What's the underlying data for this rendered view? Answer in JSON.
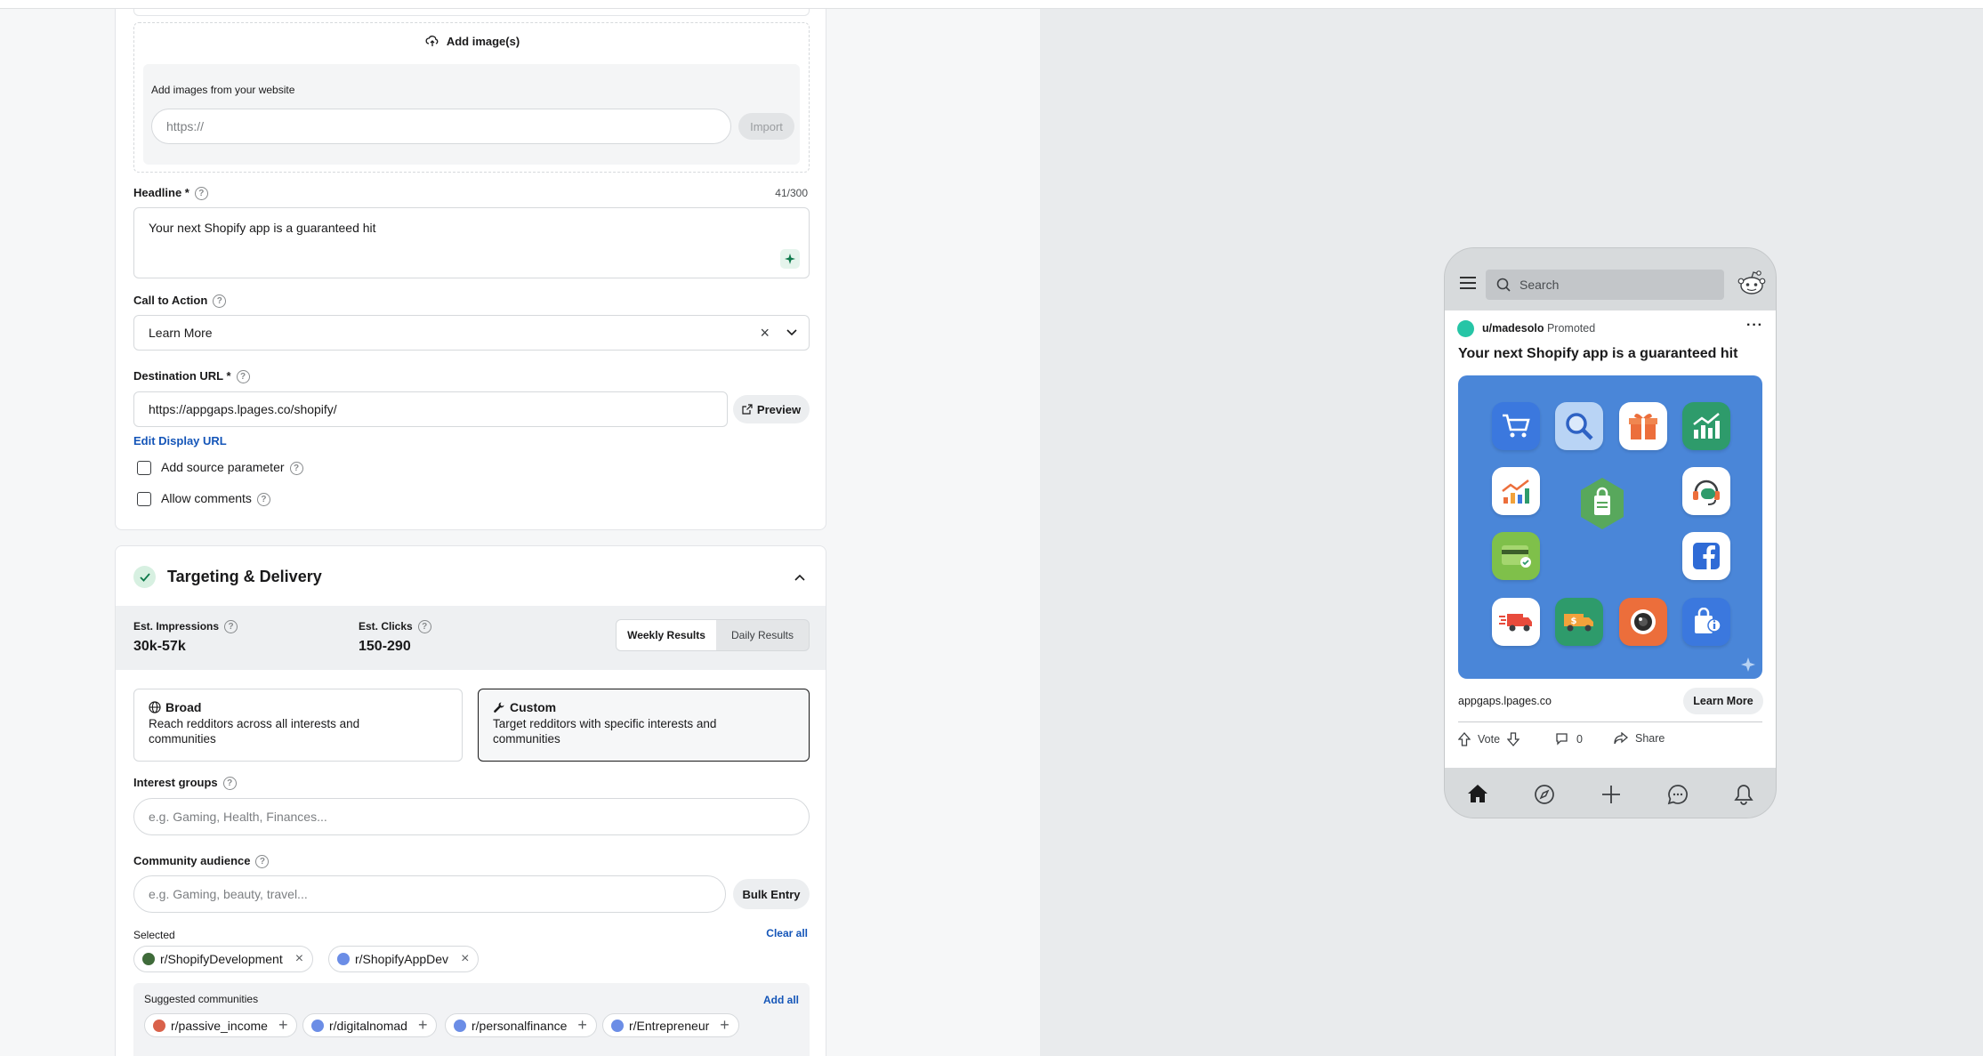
{
  "form": {
    "add_images_label": "Add image(s)",
    "website_images_label": "Add images from your website",
    "website_url_placeholder": "https://",
    "import_label": "Import",
    "headline_label": "Headline *",
    "headline_count": "41/300",
    "headline_value": "Your next Shopify app is a guaranteed hit",
    "cta_label": "Call to Action",
    "cta_value": "Learn More",
    "destination_label": "Destination URL *",
    "destination_value": "https://appgaps.lpages.co/shopify/",
    "preview_label": "Preview",
    "edit_display_url": "Edit Display URL",
    "add_source_param": "Add source parameter",
    "allow_comments": "Allow comments"
  },
  "targeting": {
    "title": "Targeting & Delivery",
    "impressions_label": "Est. Impressions",
    "impressions_value": "30k-57k",
    "clicks_label": "Est. Clicks",
    "clicks_value": "150-290",
    "weekly_tab": "Weekly Results",
    "daily_tab": "Daily Results",
    "broad_title": "Broad",
    "broad_desc": "Reach redditors across all interests and communities",
    "custom_title": "Custom",
    "custom_desc": "Target redditors with specific interests and communities",
    "interest_label": "Interest groups",
    "interest_placeholder": "e.g. Gaming, Health, Finances...",
    "community_label": "Community audience",
    "community_placeholder": "e.g. Gaming, beauty, travel...",
    "bulk_entry": "Bulk Entry",
    "selected_label": "Selected",
    "clear_all": "Clear all",
    "selected": [
      "r/ShopifyDevelopment",
      "r/ShopifyAppDev"
    ],
    "suggested_label": "Suggested communities",
    "add_all": "Add all",
    "suggested": [
      "r/passive_income",
      "r/digitalnomad",
      "r/personalfinance",
      "r/Entrepreneur"
    ]
  },
  "preview": {
    "search_placeholder": "Search",
    "username": "u/madesolo",
    "promoted": "Promoted",
    "headline": "Your next Shopify app is a guaranteed hit",
    "domain": "appgaps.lpages.co",
    "cta": "Learn More",
    "vote": "Vote",
    "comments": "0",
    "share": "Share"
  },
  "colors": {
    "accent": "#1455b8",
    "ad_background": "#4a86d8",
    "success": "#0f9d58"
  },
  "icons": [
    "cart-icon",
    "search-icon",
    "gift-icon",
    "chart-icon",
    "growth-chart-icon",
    "shopify-bag-icon",
    "support-icon",
    "card-icon",
    "facebook-icon",
    "delivery-truck-icon",
    "money-truck-icon",
    "camera-icon",
    "info-bag-icon"
  ]
}
